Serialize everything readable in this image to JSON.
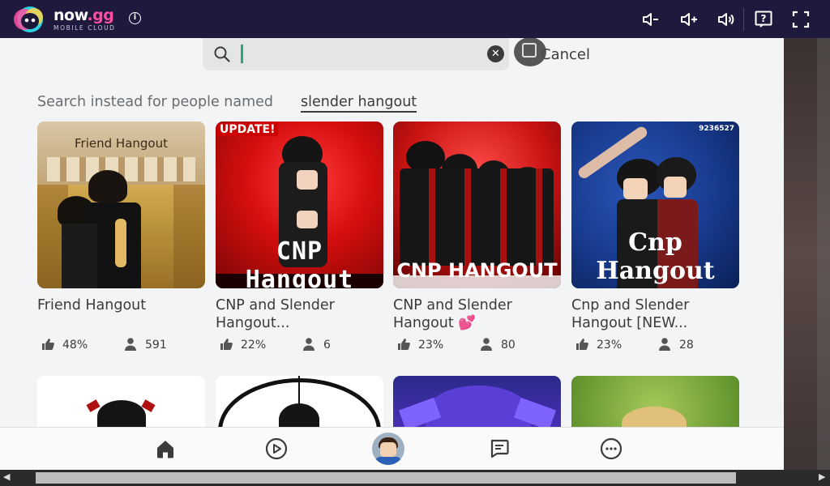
{
  "topbar": {
    "brand_main": "now",
    "brand_dot": ".gg",
    "brand_sub": "MOBILE CLOUD",
    "info_label": "i",
    "icons": [
      "volume-down-icon",
      "volume-up-icon",
      "volume-icon",
      "help-icon",
      "fullscreen-icon"
    ]
  },
  "search": {
    "value": "",
    "clear_label": "✕",
    "cancel_label": "Cancel"
  },
  "instead": {
    "prefix": "Search instead for people named",
    "query": "slender hangout"
  },
  "games": [
    {
      "title": "Friend Hangout",
      "thumb_text": "Friend Hangout",
      "like": "48%",
      "players": "591"
    },
    {
      "title": "CNP and Slender Hangout...",
      "badge": "UPDATE!",
      "thumb_text": "CNP Hangout",
      "like": "22%",
      "players": "6"
    },
    {
      "title": "CNP and Slender Hangout 💕",
      "thumb_text": "CNP HANGOUT",
      "like": "23%",
      "players": "80"
    },
    {
      "title": "Cnp and Slender Hangout [NEW...",
      "thumb_text": "Cnp Hangout",
      "corner_code": "9236527",
      "like": "23%",
      "players": "28"
    }
  ],
  "bottom_nav": [
    "home-icon",
    "play-icon",
    "avatar",
    "chat-icon",
    "more-icon"
  ],
  "colors": {
    "topbar": "#1f1a3d",
    "accent_pink": "#ff4fa0",
    "text": "#393b3d",
    "background": "#f2f4f5",
    "caret": "#2aa57a"
  }
}
